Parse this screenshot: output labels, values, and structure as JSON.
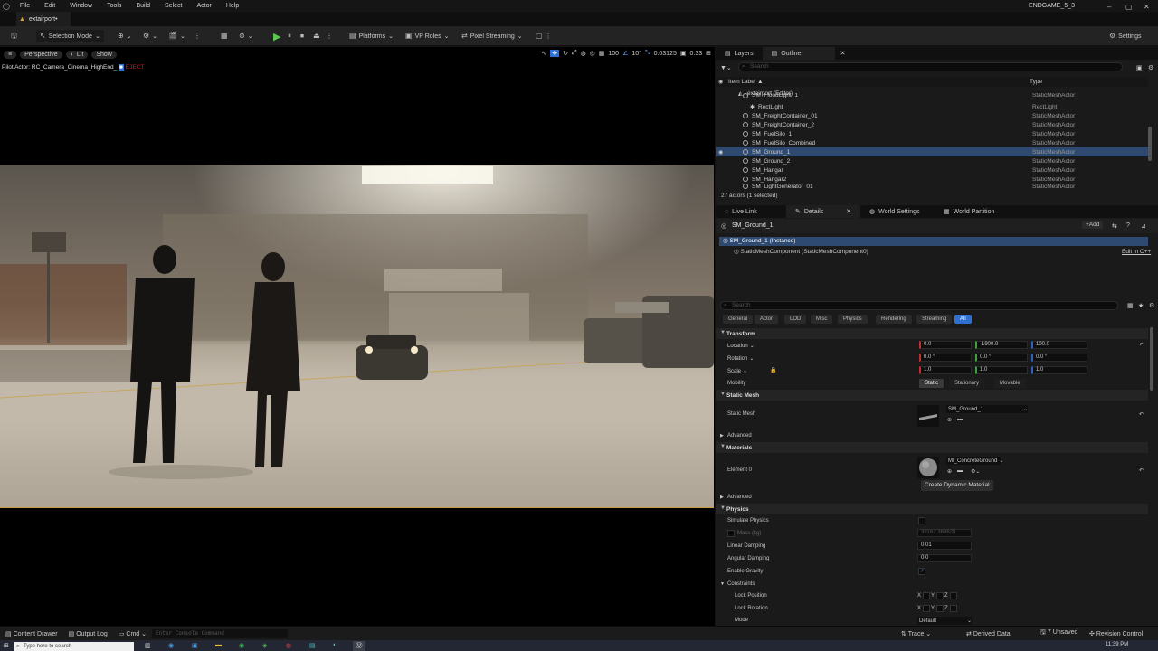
{
  "menu": [
    "File",
    "Edit",
    "Window",
    "Tools",
    "Build",
    "Select",
    "Actor",
    "Help"
  ],
  "project_name": "ENDGAME_5_3",
  "level_tab": "extairport•",
  "toolbar": {
    "selection_mode": "Selection Mode",
    "platforms": "Platforms",
    "vp_roles": "VP Roles",
    "pixel_streaming": "Pixel Streaming",
    "settings": "Settings"
  },
  "viewport": {
    "perspective": "Perspective",
    "lit": "Lit",
    "show": "Show",
    "pilot_label": "Pilot Actor: RC_Camera_Cinema_HighEnd_",
    "pilot_suffix": "EJECT",
    "grid_value": "100",
    "angle_value": "10°",
    "scale_value": "0.03125",
    "speed_value": "0.33"
  },
  "outliner": {
    "tab_layers": "Layers",
    "tab_outliner": "Outliner",
    "search_placeholder": "Search",
    "col_label": "Item Label ▲",
    "col_type": "Type",
    "root": "extairport (Editor)",
    "rows": [
      {
        "name": "SM_FloodLight_1",
        "type": "StaticMeshActor",
        "selected": false
      },
      {
        "name": "RectLight",
        "type": "RectLight",
        "selected": false
      },
      {
        "name": "SM_FreightContainer_01",
        "type": "StaticMeshActor",
        "selected": false
      },
      {
        "name": "SM_FreightContainer_2",
        "type": "StaticMeshActor",
        "selected": false
      },
      {
        "name": "SM_FuelSilo_1",
        "type": "StaticMeshActor",
        "selected": false
      },
      {
        "name": "SM_FuelSilo_Combined",
        "type": "StaticMeshActor",
        "selected": false
      },
      {
        "name": "SM_Ground_1",
        "type": "StaticMeshActor",
        "selected": true
      },
      {
        "name": "SM_Ground_2",
        "type": "StaticMeshActor",
        "selected": false
      },
      {
        "name": "SM_Hangar",
        "type": "StaticMeshActor",
        "selected": false
      },
      {
        "name": "SM_Hangar2",
        "type": "StaticMeshActor",
        "selected": false
      },
      {
        "name": "SM_LightGenerator_01",
        "type": "StaticMeshActor",
        "selected": false
      }
    ],
    "footer": "27 actors (1 selected)"
  },
  "details": {
    "tabs": [
      "Live Link",
      "Details",
      "World Settings",
      "World Partition"
    ],
    "actor_name": "SM_Ground_1",
    "add_label": "Add",
    "instance": "SM_Ground_1 (Instance)",
    "component": "StaticMeshComponent (StaticMeshComponent0)",
    "edit_cpp": "Edit in C++",
    "search_placeholder": "Search",
    "filters": [
      "General",
      "Actor",
      "LOD",
      "Misc",
      "Physics",
      "Rendering",
      "Streaming",
      "All"
    ],
    "transform": {
      "header": "Transform",
      "location_label": "Location",
      "location": [
        "0.0",
        "-1900.0",
        "100.0"
      ],
      "rotation_label": "Rotation",
      "rotation": [
        "0.0 °",
        "0.0 °",
        "0.0 °"
      ],
      "scale_label": "Scale",
      "scale": [
        "1.0",
        "1.0",
        "1.0"
      ],
      "mobility_label": "Mobility",
      "mobility": [
        "Static",
        "Stationary",
        "Movable"
      ]
    },
    "static_mesh": {
      "header": "Static Mesh",
      "label": "Static Mesh",
      "value": "SM_Ground_1",
      "advanced": "Advanced"
    },
    "materials": {
      "header": "Materials",
      "element_label": "Element 0",
      "value": "MI_ConcreteGround",
      "create_dynamic": "Create Dynamic Material",
      "advanced": "Advanced"
    },
    "physics": {
      "header": "Physics",
      "simulate": "Simulate Physics",
      "mass_label": "Mass (kg)",
      "mass_value": "38162.369628",
      "linear_damping_label": "Linear Damping",
      "linear_damping": "0.01",
      "angular_damping_label": "Angular Damping",
      "angular_damping": "0.0",
      "gravity_label": "Enable Gravity",
      "constraints": "Constraints",
      "lock_position": "Lock Position",
      "lock_rotation": "Lock Rotation",
      "mode_label": "Mode",
      "mode_value": "Default",
      "xyz": [
        "X",
        "Y",
        "Z"
      ]
    }
  },
  "statusbar": {
    "content_drawer": "Content Drawer",
    "output_log": "Output Log",
    "cmd": "Cmd",
    "console_placeholder": "Enter Console Command",
    "trace": "Trace",
    "derived_data": "Derived Data",
    "unsaved": "7 Unsaved",
    "revision_control": "Revision Control"
  },
  "taskbar": {
    "search_placeholder": "Type here to search",
    "time": "11:39 PM"
  },
  "colors": {
    "selection": "#2f4a70",
    "accent_blue": "#2f6fd0",
    "play_green": "#5ac84f"
  }
}
